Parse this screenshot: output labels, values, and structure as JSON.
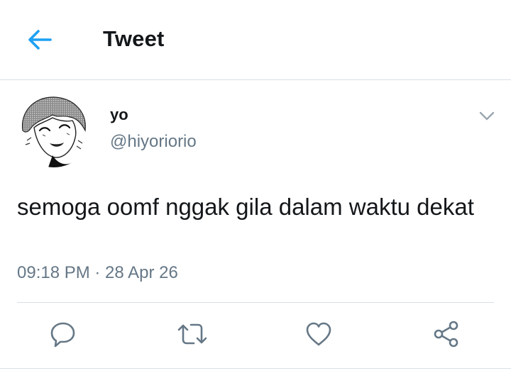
{
  "header": {
    "title": "Tweet",
    "back_icon": "arrow-left-icon"
  },
  "colors": {
    "accent": "#1da1f2",
    "text": "#14171a",
    "secondary": "#657786",
    "divider": "#d8dfe5"
  },
  "tweet": {
    "author": {
      "display_name": "yo",
      "handle": "@hiyoriorio"
    },
    "text": "semoga oomf nggak gila dalam waktu dekat",
    "timestamp": "09:18 PM · 28 Apr 26"
  },
  "actions": [
    {
      "name": "reply",
      "icon": "reply-icon"
    },
    {
      "name": "retweet",
      "icon": "retweet-icon"
    },
    {
      "name": "like",
      "icon": "heart-icon"
    },
    {
      "name": "share",
      "icon": "share-icon"
    }
  ]
}
